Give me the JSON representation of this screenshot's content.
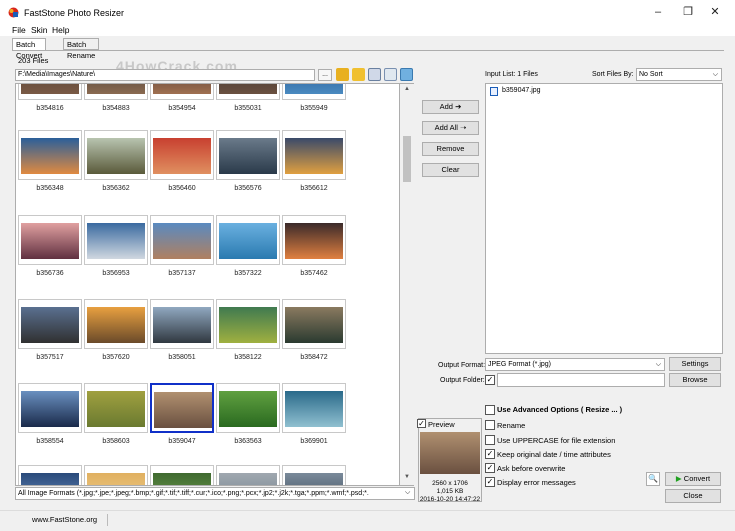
{
  "window": {
    "title": "FastStone Photo Resizer",
    "minimize": "–",
    "maximize": "❐",
    "close": "✕"
  },
  "menu": [
    "File",
    "Skin",
    "Help"
  ],
  "tabs": [
    {
      "label": "Batch Convert",
      "active": true
    },
    {
      "label": "Batch Rename",
      "active": false
    }
  ],
  "browser": {
    "file_count": "203 Files",
    "path": "F:\\Media\\Images\\Nature\\",
    "browse_label": "...",
    "watermark": "4HowCrack.com",
    "format_filter": "All Image Formats (*.jpg;*.jpe;*.jpeg;*.bmp;*.gif;*.tif;*.tiff;*.cur;*.ico;*.png;*.pcx;*.jp2;*.j2k;*.tga;*.ppm;*.wmf;*.psd;*.",
    "thumbnails": [
      {
        "label": "b354816",
        "colors": [
          "#4b3a30",
          "#7a5a45"
        ]
      },
      {
        "label": "b354883",
        "colors": [
          "#3a3434",
          "#8a6a50"
        ]
      },
      {
        "label": "b354954",
        "colors": [
          "#403030",
          "#a07050"
        ]
      },
      {
        "label": "b355031",
        "colors": [
          "#38302e",
          "#6a5040"
        ]
      },
      {
        "label": "b355949",
        "colors": [
          "#1f4f8a",
          "#4a8ac0"
        ]
      },
      {
        "label": "b356348",
        "colors": [
          "#2a5f9a",
          "#e08a40"
        ]
      },
      {
        "label": "b356362",
        "colors": [
          "#b8c4b0",
          "#5a5a3a"
        ]
      },
      {
        "label": "b356460",
        "colors": [
          "#c84030",
          "#e09060"
        ]
      },
      {
        "label": "b356576",
        "colors": [
          "#6a7a8a",
          "#2a3a4a"
        ]
      },
      {
        "label": "b356612",
        "colors": [
          "#3a4a6a",
          "#e0a040"
        ]
      },
      {
        "label": "b356736",
        "colors": [
          "#e0a0a0",
          "#603040"
        ]
      },
      {
        "label": "b356953",
        "colors": [
          "#3a6aa0",
          "#d0d8e0"
        ]
      },
      {
        "label": "b357137",
        "colors": [
          "#5a8ac0",
          "#b08060"
        ]
      },
      {
        "label": "b357322",
        "colors": [
          "#6ab0e0",
          "#2a7ab0"
        ]
      },
      {
        "label": "b357462",
        "colors": [
          "#3a2a2a",
          "#e08040"
        ]
      },
      {
        "label": "b357517",
        "colors": [
          "#5a7090",
          "#303030"
        ]
      },
      {
        "label": "b357620",
        "colors": [
          "#e8a040",
          "#6a4a2a"
        ]
      },
      {
        "label": "b358051",
        "colors": [
          "#90a8c0",
          "#303840"
        ]
      },
      {
        "label": "b358122",
        "colors": [
          "#407a50",
          "#a0b040"
        ]
      },
      {
        "label": "b358472",
        "colors": [
          "#8a7a60",
          "#2a3a30"
        ]
      },
      {
        "label": "b358554",
        "colors": [
          "#6a90c0",
          "#1a2a4a"
        ]
      },
      {
        "label": "b358603",
        "colors": [
          "#a0a040",
          "#6a7a30"
        ]
      },
      {
        "label": "b359047",
        "colors": [
          "#b09070",
          "#6a5040"
        ],
        "selected": true
      },
      {
        "label": "b363563",
        "colors": [
          "#60a040",
          "#2a6a20"
        ]
      },
      {
        "label": "b369901",
        "colors": [
          "#2a6a8a",
          "#90c0d0"
        ]
      },
      {
        "label": "",
        "colors": [
          "#2a4a7a",
          "#6a90c0"
        ]
      },
      {
        "label": "",
        "colors": [
          "#e0b060",
          "#f0d090"
        ]
      },
      {
        "label": "",
        "colors": [
          "#406a30",
          "#70a050"
        ]
      },
      {
        "label": "",
        "colors": [
          "#a0a8b0",
          "#70808a"
        ]
      },
      {
        "label": "",
        "colors": [
          "#7a8a9a",
          "#3a4a5a"
        ]
      }
    ]
  },
  "buttons": {
    "add": "Add",
    "add_all": "Add All",
    "remove": "Remove",
    "clear": "Clear"
  },
  "input_list": {
    "label": "Input List:  1 Files",
    "sort_label": "Sort Files By:",
    "sort_value": "No Sort",
    "items": [
      "b359047.jpg"
    ]
  },
  "output": {
    "format_label": "Output Format:",
    "format_value": "JPEG Format (*.jpg)",
    "settings_label": "Settings",
    "folder_label": "Output Folder:",
    "folder_value": "",
    "browse_label": "Browse"
  },
  "options": {
    "advanced": {
      "label": "Use Advanced Options ( Resize ... )",
      "checked": false
    },
    "rename": {
      "label": "Rename",
      "checked": false
    },
    "uppercase": {
      "label": "Use UPPERCASE for file extension",
      "checked": false
    },
    "keep_date": {
      "label": "Keep original date / time attributes",
      "checked": true
    },
    "ask_overwrite": {
      "label": "Ask before overwrite",
      "checked": true
    },
    "display_errors": {
      "label": "Display error messages",
      "checked": true
    }
  },
  "preview": {
    "label": "Preview",
    "checked": true,
    "dimensions": "2560 x 1706",
    "size": "1,015 KB",
    "date": "2016-10-20 14:47:22",
    "colors": [
      "#b09070",
      "#6a5040"
    ]
  },
  "actions": {
    "convert": "Convert",
    "close": "Close"
  },
  "status": {
    "text": "www.FastStone.org"
  }
}
